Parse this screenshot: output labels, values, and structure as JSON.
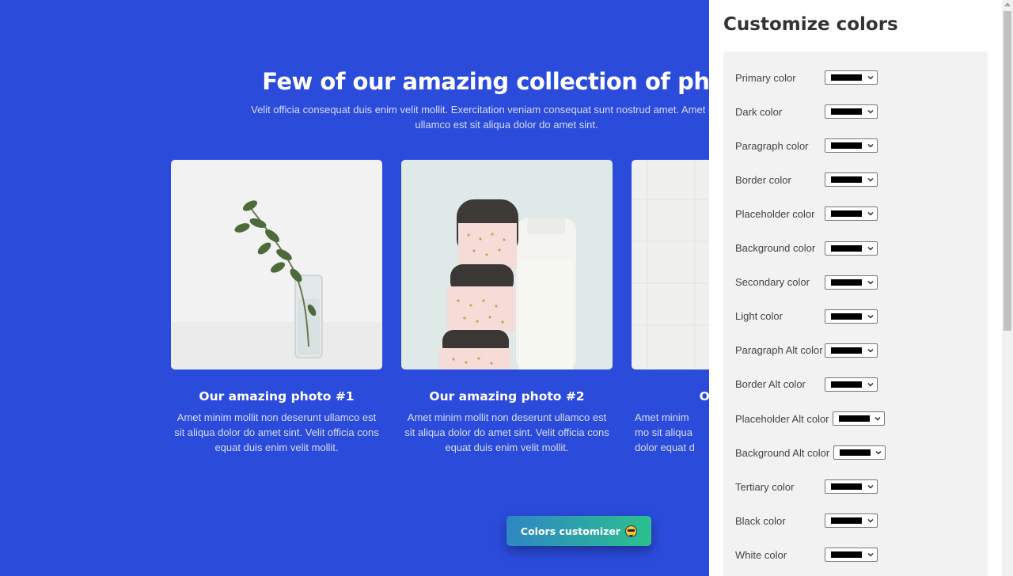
{
  "hero": {
    "title": "Few of our amazing collection of photo",
    "subtitle": "Velit officia consequat duis enim velit mollit. Exercitation veniam consequat sunt nostrud amet. Amet mi deserunt ullamco est sit aliqua dolor do amet sint."
  },
  "cards": [
    {
      "title": "Our amazing photo #1",
      "text": "Amet minim mollit non deserunt ullamco est sit aliqua dolor do amet sint. Velit officia cons equat duis enim velit mollit."
    },
    {
      "title": "Our amazing photo #2",
      "text": "Amet minim mollit non deserunt ullamco est sit aliqua dolor do amet sint. Velit officia cons equat duis enim velit mollit."
    },
    {
      "title": "Our am",
      "text": "Amet minim mo sit aliqua dolor equat d"
    }
  ],
  "fab": {
    "label": "Colors customizer"
  },
  "customizer": {
    "title": "Customize colors",
    "fields": [
      "Primary color",
      "Dark color",
      "Paragraph color",
      "Border color",
      "Placeholder color",
      "Background color",
      "Secondary color",
      "Light color",
      "Paragraph Alt color",
      "Border Alt color",
      "Placeholder Alt color",
      "Background Alt color",
      "Tertiary color",
      "Black color",
      "White color"
    ],
    "swatch_value": "#000000"
  },
  "colors": {
    "page_background": "#2b4bdb",
    "drawer_background": "#ffffff",
    "panel_background": "#f2f2f2",
    "fab_gradient_start": "#2f86c4",
    "fab_gradient_end": "#2bc08e"
  },
  "icons": {
    "fab_emoji": "smiling-face-with-sunglasses",
    "select_caret": "chevron-down-icon"
  }
}
